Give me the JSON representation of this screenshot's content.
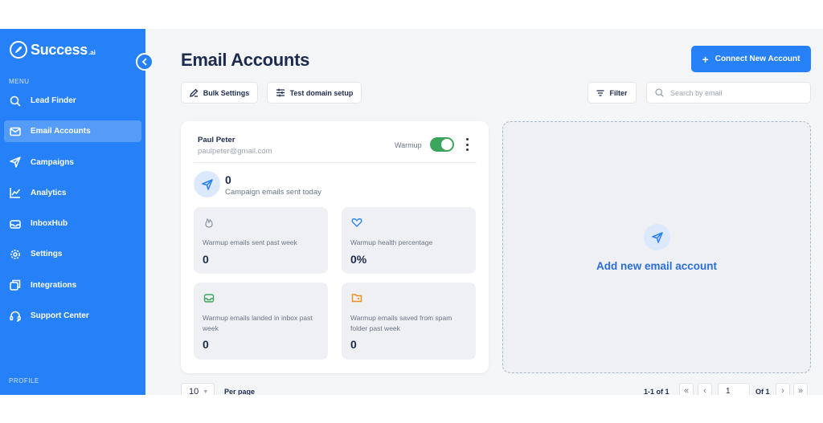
{
  "brand": {
    "name": "Success",
    "suffix": ".ai",
    "accent": "#2680f7"
  },
  "sidebar": {
    "menu_label": "MENU",
    "profile_label": "PROFILE",
    "items": [
      {
        "label": "Lead Finder",
        "icon": "search-icon"
      },
      {
        "label": "Email Accounts",
        "icon": "mail-icon",
        "active": true
      },
      {
        "label": "Campaigns",
        "icon": "send-icon"
      },
      {
        "label": "Analytics",
        "icon": "chart-line-icon"
      },
      {
        "label": "InboxHub",
        "icon": "inbox-icon"
      },
      {
        "label": "Settings",
        "icon": "gear-icon"
      },
      {
        "label": "Integrations",
        "icon": "integrations-icon"
      },
      {
        "label": "Support Center",
        "icon": "headset-icon"
      }
    ]
  },
  "header": {
    "title": "Email Accounts",
    "connect_label": "Connect New Account"
  },
  "toolbar": {
    "bulk_settings": "Bulk Settings",
    "test_domain": "Test domain setup",
    "filter": "Filter",
    "search_placeholder": "Search by email"
  },
  "account": {
    "name": "Paul Peter",
    "email": "paulpeter@gmail.com",
    "warmup_label": "Warmup",
    "warmup_enabled": true,
    "sent_count": "0",
    "sent_label": "Campaign emails sent today",
    "stats": [
      {
        "label": "Warmup emails sent past week",
        "value": "0",
        "icon": "flame-icon",
        "icon_color": "#8a93a3"
      },
      {
        "label": "Warmup health percentage",
        "value": "0%",
        "icon": "heart-icon",
        "icon_color": "#2680f7"
      },
      {
        "label": "Warmup emails landed in inbox past week",
        "value": "0",
        "icon": "inbox-tray-icon",
        "icon_color": "#3ca55c"
      },
      {
        "label": "Warmup emails saved from spam folder past week",
        "value": "0",
        "icon": "folder-icon",
        "icon_color": "#f08c1b"
      }
    ]
  },
  "add_account": {
    "label": "Add new email account"
  },
  "pagination": {
    "per_page_value": "10",
    "per_page_label": "Per page",
    "range": "1-1 of 1",
    "page": "1",
    "of_label": "Of 1"
  }
}
